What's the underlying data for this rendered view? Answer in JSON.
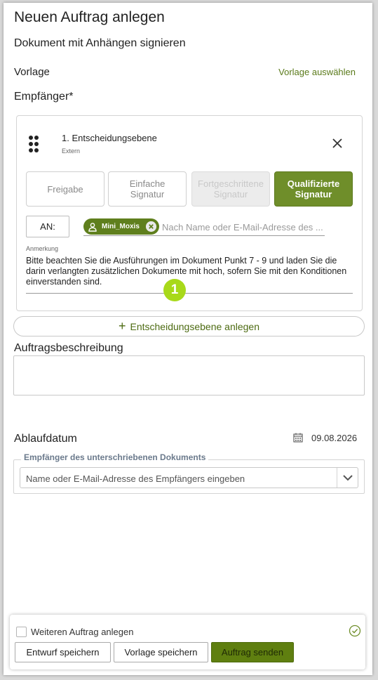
{
  "header": {
    "title": "Neuen Auftrag anlegen",
    "subtitle": "Dokument mit Anhängen signieren"
  },
  "vorlage": {
    "label": "Vorlage",
    "link": "Vorlage auswählen"
  },
  "recipients": {
    "label": "Empfänger*",
    "level": {
      "title": "1. Entscheidungsebene",
      "subtitle": "Extern",
      "signature_types": [
        {
          "label": "Freigabe",
          "state": "normal"
        },
        {
          "label": "Einfache Signatur",
          "state": "normal"
        },
        {
          "label": "Fortgeschrittene Signatur",
          "state": "disabled"
        },
        {
          "label": "Qualifizierte Signatur",
          "state": "selected"
        }
      ],
      "an_label": "AN:",
      "chip": "Mini_Moxis",
      "recipient_placeholder": "Nach Name oder E-Mail-Adresse des ...",
      "anmerkung_label": "Anmerkung",
      "anmerkung_text": "Bitte beachten Sie die Ausführungen im Dokument Punkt 7 - 9 und laden Sie die darin verlangten zusätzlichen Dokumente mit hoch, sofern Sie mit den Konditionen einverstanden sind.",
      "badge": "1"
    },
    "add_level_label": "Entscheidungsebene anlegen"
  },
  "description": {
    "label": "Auftragsbeschreibung",
    "value": ""
  },
  "ablauf": {
    "label": "Ablaufdatum",
    "date": "09.08.2026"
  },
  "signed_recipient": {
    "legend": "Empfänger des unterschriebenen Dokuments",
    "placeholder": "Name oder E-Mail-Adresse des Empfängers eingeben"
  },
  "footer": {
    "checkbox_label": "Weiteren Auftrag anlegen",
    "draft_button": "Entwurf speichern",
    "template_button": "Vorlage speichern",
    "send_button": "Auftrag senden"
  },
  "colors": {
    "accent": "#6f8e2a",
    "badge": "#a8d91a",
    "link": "#5a7a1a"
  }
}
